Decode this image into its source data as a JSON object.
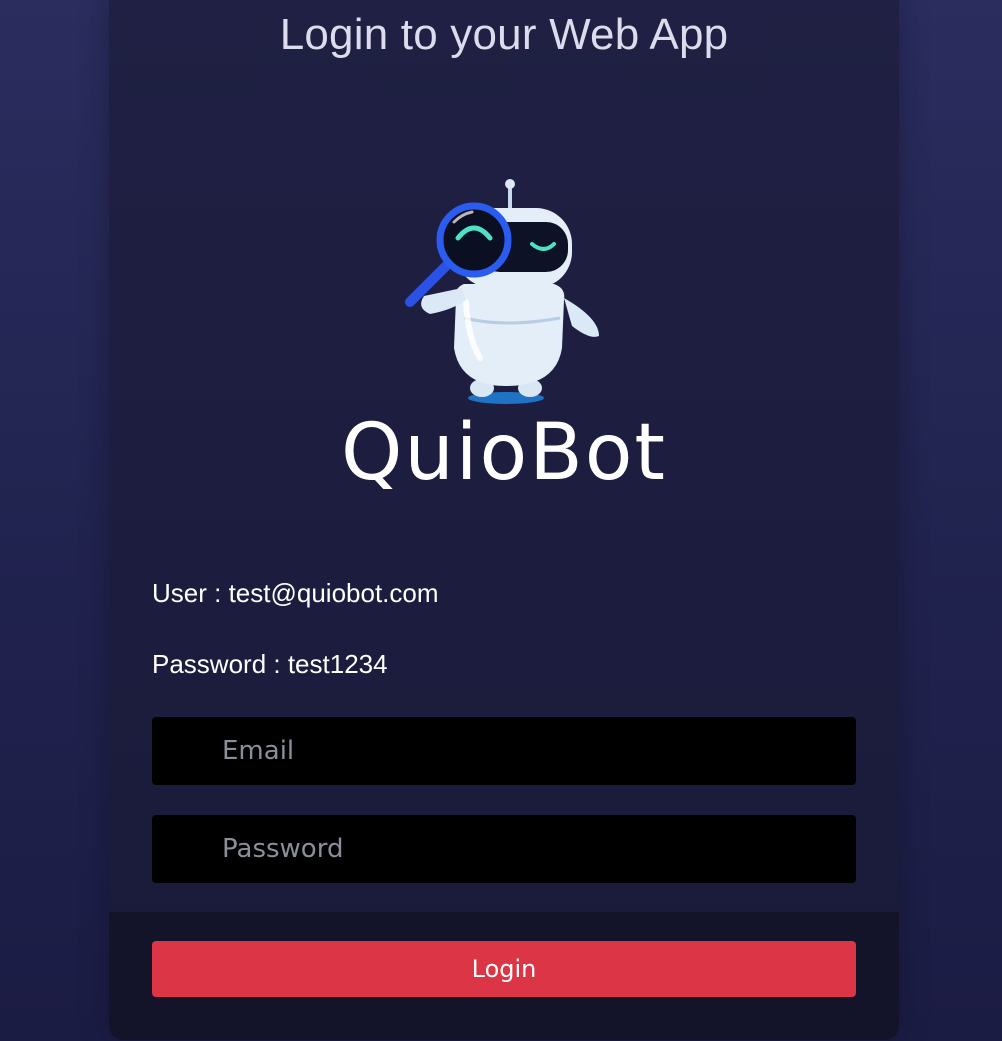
{
  "page": {
    "title": "Login to your Web App"
  },
  "brand": {
    "name": "QuioBot",
    "logo_icon": "robot-with-magnifier-icon"
  },
  "credentials": {
    "user_text": "User : test@quiobot.com",
    "password_text": "Password : test1234"
  },
  "form": {
    "email": {
      "value": "",
      "placeholder": "Email"
    },
    "password": {
      "value": "",
      "placeholder": "Password"
    },
    "login_label": "Login"
  },
  "colors": {
    "background": "#222451",
    "card": "#1e1f42",
    "footer": "#131429",
    "input": "#000000",
    "login_button": "#dc3545"
  }
}
